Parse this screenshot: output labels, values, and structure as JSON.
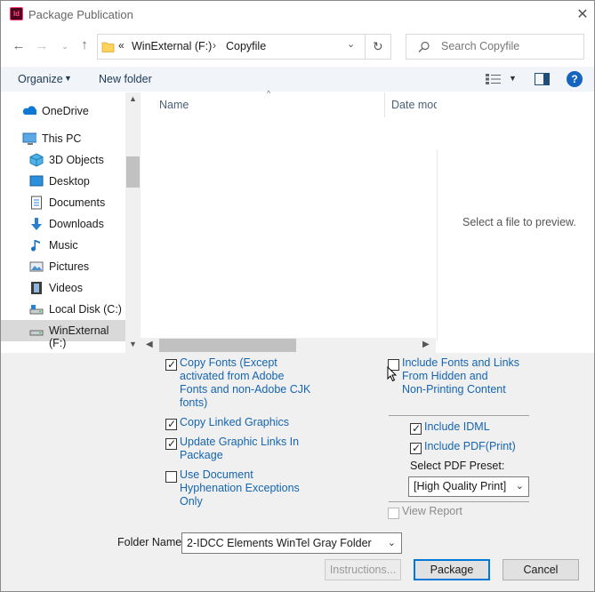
{
  "window": {
    "title": "Package Publication",
    "app_icon_text": "Id"
  },
  "address": {
    "prefix": "«",
    "crumbs": [
      "WinExternal (F:)",
      "Copyfile"
    ],
    "separator": "›",
    "search_placeholder": "Search Copyfile"
  },
  "toolbar": {
    "organize_label": "Organize",
    "new_folder_label": "New folder"
  },
  "sidebar": {
    "items": [
      {
        "label": "OneDrive"
      },
      {
        "label": "This PC"
      },
      {
        "label": "3D Objects"
      },
      {
        "label": "Desktop"
      },
      {
        "label": "Documents"
      },
      {
        "label": "Downloads"
      },
      {
        "label": "Music"
      },
      {
        "label": "Pictures"
      },
      {
        "label": "Videos"
      },
      {
        "label": "Local Disk (C:)"
      },
      {
        "label": "WinExternal (F:)"
      }
    ],
    "selected": "WinExternal (F:)"
  },
  "file_list": {
    "columns": [
      "Name",
      "Date mod"
    ],
    "preview_text": "Select a file to preview."
  },
  "options": {
    "copy_fonts": {
      "label_lines": [
        "Copy Fonts (Except",
        "activated from Adobe",
        "Fonts and non-Adobe CJK",
        "fonts)"
      ],
      "checked": true
    },
    "copy_linked_graphics": {
      "label": "Copy Linked Graphics",
      "checked": true
    },
    "update_graphic_links": {
      "label_lines": [
        "Update Graphic Links In",
        "Package"
      ],
      "checked": true
    },
    "use_hyphenation": {
      "label_lines": [
        "Use Document",
        "Hyphenation Exceptions",
        "Only"
      ],
      "checked": false
    },
    "include_hidden": {
      "label_lines": [
        "Include Fonts and Links",
        "From Hidden and",
        "Non-Printing Content"
      ],
      "checked": false
    },
    "include_idml": {
      "label": "Include IDML",
      "checked": true
    },
    "include_pdf": {
      "label": "Include PDF(Print)",
      "checked": true
    },
    "pdf_preset_label": "Select PDF Preset:",
    "pdf_preset_value": "[High Quality Print]",
    "view_report": {
      "label": "View Report",
      "checked": false,
      "enabled": false
    }
  },
  "folder_name": {
    "label": "Folder Name",
    "value": "2-IDCC Elements WinTel Gray Folder"
  },
  "buttons": {
    "instructions": "Instructions...",
    "package": "Package",
    "cancel": "Cancel"
  },
  "colors": {
    "accent_link": "#1565b0",
    "onedrive": "#0f78d4",
    "folder": "#ffd35c"
  }
}
